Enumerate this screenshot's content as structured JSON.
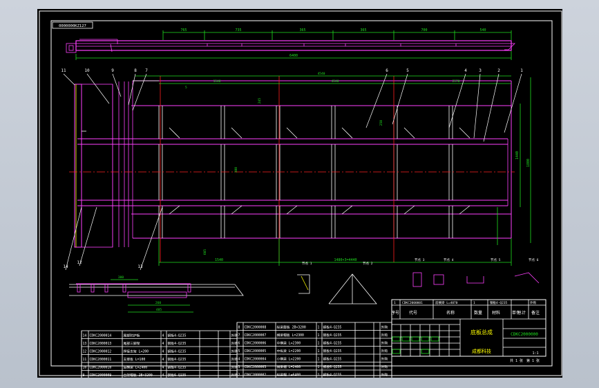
{
  "drawing": {
    "stamp": "0000000KZ127",
    "colors": {
      "background": "#000000",
      "frame": "#ffffff",
      "profile": "#ff40ff",
      "centerline": "#ff2020",
      "dimension": "#20e020",
      "leader": "#ffffff",
      "hatch": "#ffff00"
    },
    "balloons": [
      "11",
      "10",
      "9",
      "8",
      "7",
      "6",
      "5",
      "4",
      "3",
      "2",
      "1",
      "14",
      "12",
      "13"
    ],
    "top_dims": [
      "765",
      "735",
      "365",
      "365",
      "700",
      "540"
    ],
    "overall_top": "6400",
    "plan_dims": {
      "upper_left": "1540",
      "upper_mid": "4540",
      "upper_right": "2570",
      "top_span": "4540",
      "small_mark": "5",
      "side_a": "245",
      "mid_a": "300",
      "mid_b": "605",
      "mid_c": "250",
      "right_height": "1800",
      "right_lower": "1440",
      "bottom_left": "1540",
      "bottom_mid": "1480×3=4440",
      "rail_dim": "880"
    },
    "detail_labels": [
      "节点 1",
      "节点 2",
      "节点 3",
      "节点 4",
      "节点 5",
      "节点 6"
    ],
    "elevation_dims": [
      "300",
      "260",
      "485"
    ],
    "bom_left": [
      [
        "14",
        "CDKC2000014",
        "尾部防护板",
        "4",
        "钢板4-Q235",
        "",
        "",
        "外购"
      ],
      [
        "13",
        "CDKC2000013",
        "尾部三脚架",
        "4",
        "钢板4-Q235",
        "",
        "",
        "外购"
      ],
      [
        "12",
        "CDKC2000012",
        "焊接支架 L=200",
        "4",
        "钢板4-Q235",
        "",
        "",
        "外购"
      ],
      [
        "11",
        "CDKC2000011",
        "支撑板 L=100",
        "4",
        "钢板4-Q235",
        "",
        "",
        "外购"
      ],
      [
        "10",
        "CDKC2000010",
        "后横梁 L=2400",
        "4",
        "钢板4-Q235",
        "",
        "",
        "外购"
      ],
      [
        "9",
        "CDKC2000009",
        "台架帽板 2B×3200",
        "4",
        "钢板6-Q235",
        "",
        "",
        "外购"
      ]
    ],
    "bom_right": [
      [
        "8",
        "CDKC2000008",
        "纵梁腹板 2B×3200",
        "1",
        "钢板4-Q235",
        "",
        "",
        "外购"
      ],
      [
        "7",
        "CDKC2000007",
        "横梁帽板 L=2300",
        "1",
        "钢板4-Q235",
        "",
        "",
        "外购"
      ],
      [
        "6",
        "CDKC2000006",
        "中横梁 L=2300",
        "1",
        "钢板4-Q235",
        "",
        "",
        "外购"
      ],
      [
        "5",
        "CDKC2000005",
        "中纵梁 L=2200",
        "1",
        "钢板4-Q235",
        "",
        "",
        "外购"
      ],
      [
        "4",
        "CDKC2000004",
        "小横梁 L=2200",
        "1",
        "钢板4-Q235",
        "",
        "",
        "外购"
      ],
      [
        "3",
        "CDKC2000003",
        "横梁帽 L=2400",
        "1",
        "钢板6-Q235",
        "",
        "",
        "外购"
      ],
      [
        "2",
        "CDKC2000002",
        "纵梁帽 L=6400",
        "1",
        "钢板4-Q235",
        "",
        "",
        "外购"
      ],
      [
        "1",
        "CDKC2000001",
        "纵梁 CDKC2000 L3700",
        "1",
        "钢板6-Q235",
        "",
        "",
        "外购"
      ]
    ],
    "title_block": {
      "header_row": [
        "1",
        "CDKC2000001",
        "前横梁 L=4070",
        "1",
        "钢板4-Q235",
        "",
        "外购"
      ],
      "headers": [
        "序号",
        "代号",
        "名称",
        "数量",
        "材料",
        "单件",
        "总计",
        "备注"
      ],
      "name": "底板总成",
      "doc_no": "CDKC2000000",
      "company": "成都科技",
      "scale": "1:1",
      "sheets": "共 1 张",
      "sheet_no": "第 1 张"
    }
  }
}
